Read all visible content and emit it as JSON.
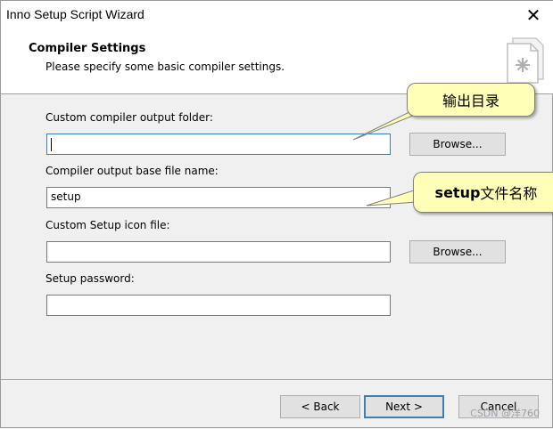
{
  "window": {
    "title": "Inno Setup Script Wizard",
    "close_glyph": "✕"
  },
  "header": {
    "title": "Compiler Settings",
    "subtitle": "Please specify some basic compiler settings."
  },
  "fields": {
    "output_folder": {
      "label": "Custom compiler output folder:",
      "value": "",
      "browse_label": "Browse..."
    },
    "base_file_name": {
      "label": "Compiler output base file name:",
      "value": "setup"
    },
    "icon_file": {
      "label": "Custom Setup icon file:",
      "value": "",
      "browse_label": "Browse..."
    },
    "password": {
      "label": "Setup password:",
      "value": ""
    }
  },
  "buttons": {
    "back": "< Back",
    "next": "Next >",
    "cancel": "Cancel"
  },
  "annotations": {
    "output_dir": "输出目录",
    "setup_name_bold": "setup",
    "setup_name_rest": "文件名称"
  },
  "watermark": "CSDN @洋760",
  "colors": {
    "callout_fill": "#ffffb8",
    "focus_border": "#3c7fb1"
  },
  "icons": [
    "close-icon",
    "wizard-document-icon"
  ]
}
